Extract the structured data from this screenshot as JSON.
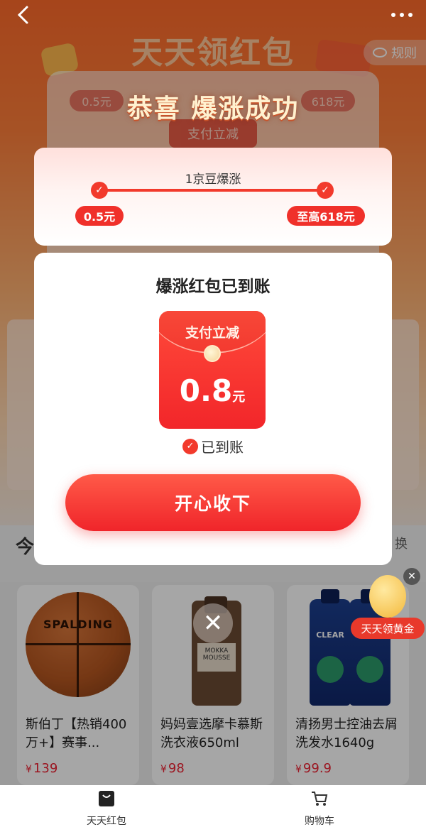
{
  "nav": {
    "back_label": "返回",
    "more_label": "更多"
  },
  "background": {
    "page_title": "天天领红包",
    "rules_label": "规则",
    "pill_left": "0.5元",
    "pill_right": "618元",
    "badge": "支付立减",
    "today_label": "今",
    "swap_label": "换"
  },
  "popup": {
    "congrats": "恭喜 爆涨成功",
    "progress": {
      "title": "1京豆爆涨",
      "from": "0.5元",
      "to": "至高618元"
    },
    "modal": {
      "title": "爆涨红包已到账",
      "envelope_title": "支付立减",
      "amount": "0.8",
      "unit": "元",
      "status": "已到账",
      "accept_button": "开心收下"
    }
  },
  "products": [
    {
      "name": "斯伯丁【热销400万+】赛事...",
      "price": "139",
      "brand_text": "SPALDING"
    },
    {
      "name": "妈妈壹选摩卡慕斯洗衣液650ml",
      "price": "98",
      "brand_text": "MOKKA MOUSSE"
    },
    {
      "name": "清扬男士控油去屑洗发水1640g",
      "price": "99.9",
      "brand_text": "CLEAR"
    }
  ],
  "currency": "¥",
  "float_widget": {
    "label": "天天领黄金"
  },
  "tabbar": [
    {
      "label": "天天红包",
      "icon": "bag-icon"
    },
    {
      "label": "购物车",
      "icon": "cart-icon"
    }
  ],
  "colors": {
    "accent": "#f0302a",
    "hero": "#ff6a2a"
  }
}
